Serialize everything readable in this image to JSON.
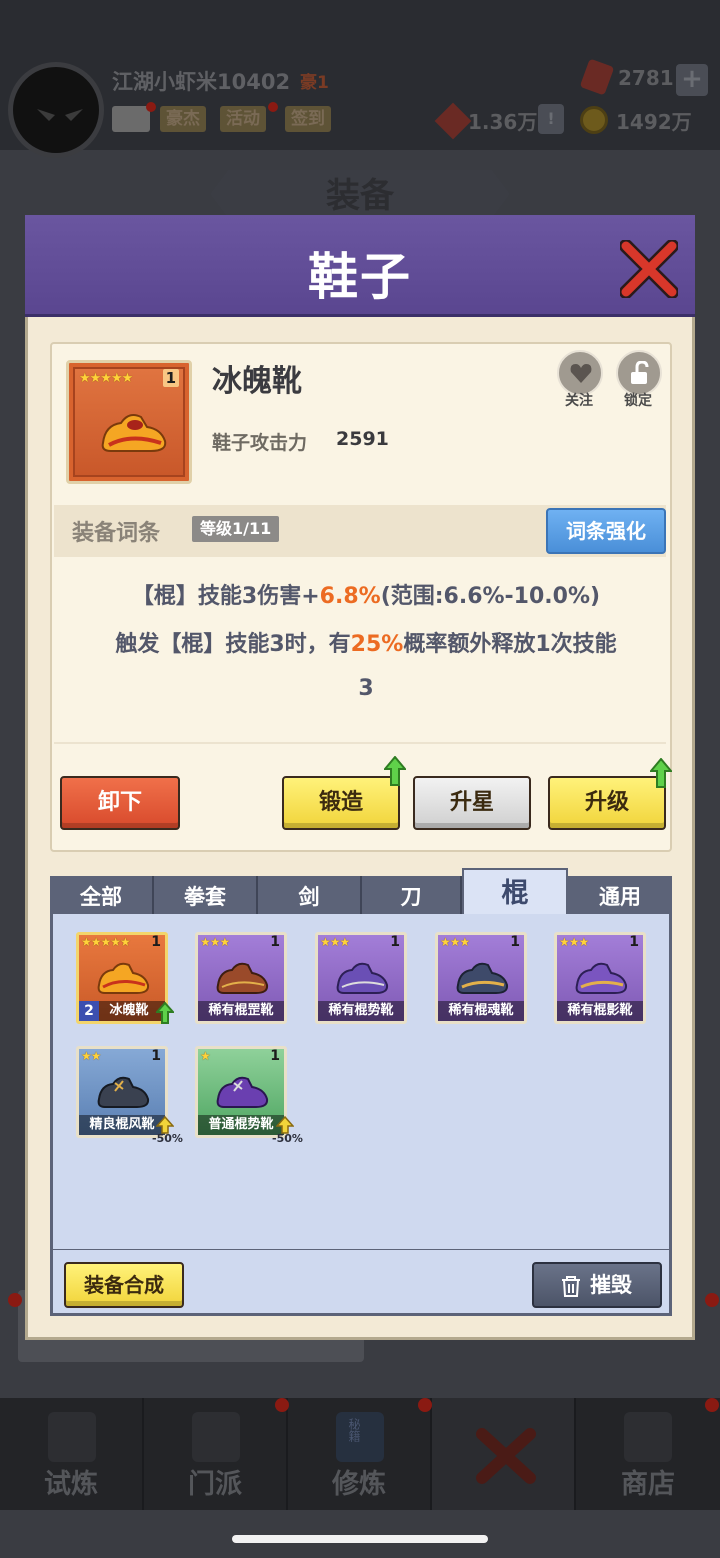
{
  "header": {
    "player_name": "江湖小虾米10402",
    "vip_label": "豪1",
    "chips": [
      "豪杰",
      "活动",
      "签到"
    ],
    "gems": "2781",
    "power": "1.36万",
    "gold": "1492万"
  },
  "background": {
    "panel_title": "装备"
  },
  "dialog": {
    "title": "鞋子",
    "item": {
      "name": "冰魄靴",
      "stars": "★★★★★",
      "count": "1",
      "stat_label": "鞋子攻击力",
      "stat_value": "2591",
      "follow_label": "关注",
      "lock_label": "锁定"
    },
    "affix": {
      "label": "装备词条",
      "level": "等级1/11",
      "enhance_button": "词条强化",
      "line1_pre": "【棍】技能3伤害+",
      "line1_hl": "6.8%",
      "line1_post": "(范围:6.6%-10.0%)",
      "line2_pre": "触发【棍】技能3时，有",
      "line2_hl": "25%",
      "line2_post": "概率额外释放1次技能",
      "line3": "3"
    },
    "buttons": {
      "unequip": "卸下",
      "forge": "锻造",
      "star_up": "升星",
      "level_up": "升级"
    },
    "tabs": [
      "全部",
      "拳套",
      "剑",
      "刀",
      "棍",
      "通用"
    ],
    "active_tab_index": 4,
    "inventory": [
      {
        "name": "冰魄靴",
        "stars": "★★★★★",
        "count": "1",
        "badge": "2",
        "rarity": "gold"
      },
      {
        "name": "稀有棍罡靴",
        "stars": "★★★",
        "count": "1",
        "rarity": "purple"
      },
      {
        "name": "稀有棍势靴",
        "stars": "★★★",
        "count": "1",
        "rarity": "purple"
      },
      {
        "name": "稀有棍魂靴",
        "stars": "★★★",
        "count": "1",
        "rarity": "purple"
      },
      {
        "name": "稀有棍影靴",
        "stars": "★★★",
        "count": "1",
        "rarity": "purple"
      },
      {
        "name": "精良棍风靴",
        "stars": "★★",
        "count": "1",
        "discount": "-50%",
        "rarity": "blue"
      },
      {
        "name": "普通棍势靴",
        "stars": "★",
        "count": "1",
        "discount": "-50%",
        "rarity": "green"
      }
    ],
    "synthesize_button": "装备合成",
    "destroy_button": "摧毁"
  },
  "nav": {
    "items": [
      "试炼",
      "门派",
      "修炼",
      "",
      "商店"
    ],
    "book_label": "秘籍"
  },
  "colors": {
    "dialog_header": "#5f4c96",
    "highlight": "#ec6b22",
    "enhance_blue": "#4a8fd8"
  }
}
